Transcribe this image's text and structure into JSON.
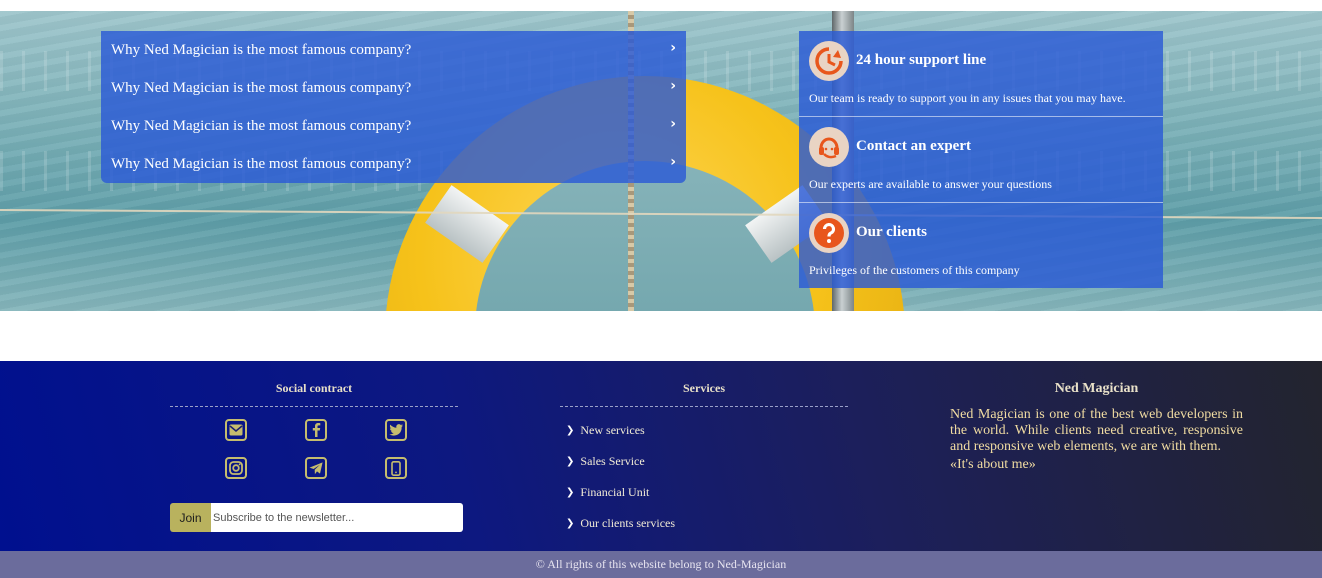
{
  "faq": {
    "items": [
      {
        "question": "Why Ned Magician is the most famous company?"
      },
      {
        "question": "Why Ned Magician is the most famous company?"
      },
      {
        "question": "Why Ned Magician is the most famous company?"
      },
      {
        "question": "Why Ned Magician is the most famous company?"
      }
    ],
    "chevron": "›"
  },
  "support": {
    "items": [
      {
        "icon": "clock-icon",
        "title": "24 hour support line",
        "description": "Our team is ready to support you in any issues that you may have."
      },
      {
        "icon": "headset-icon",
        "title": "Contact an expert",
        "description": "Our experts are available to answer your questions"
      },
      {
        "icon": "question-icon",
        "title": "Our clients",
        "description": "Privileges of the customers of this company"
      }
    ],
    "accent_color": "#e8561c"
  },
  "footer": {
    "social": {
      "heading": "Social contract",
      "icons": [
        "envelope-icon",
        "facebook-icon",
        "twitter-icon",
        "instagram-icon",
        "telegram-icon",
        "mobile-icon"
      ],
      "join_label": "Join",
      "newsletter_placeholder": "Subscribe to the newsletter..."
    },
    "services": {
      "heading": "Services",
      "links": [
        "New services",
        "Sales Service",
        "Financial Unit",
        "Our clients services"
      ]
    },
    "about": {
      "heading": "Ned Magician",
      "text": "Ned Magician is one of the best web developers in the world. While clients need creative, responsive and responsive web elements, we are with them.",
      "link": "«It's about me»"
    },
    "copyright": "© All rights of this website belong to Ned-Magician"
  }
}
